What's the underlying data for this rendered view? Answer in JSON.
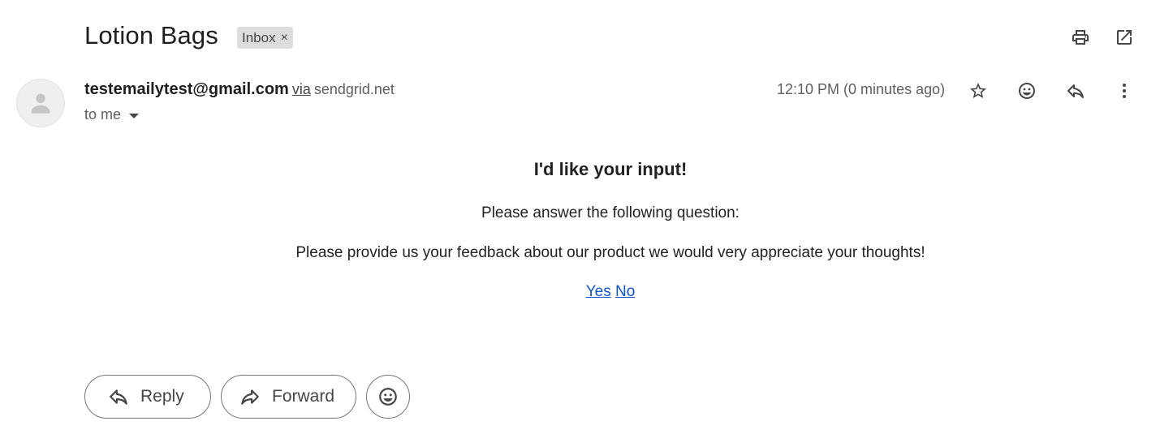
{
  "email": {
    "subject": "Lotion Bags",
    "label": "Inbox",
    "label_remove": "×",
    "sender_email": "testemailytest@gmail.com",
    "via": "via",
    "via_domain": "sendgrid.net",
    "recipients": "to me",
    "timestamp": "12:10 PM (0 minutes ago)"
  },
  "body": {
    "heading": "I'd like your input!",
    "line1": "Please answer the following question:",
    "line2": "Please provide us your feedback about our product we would very appreciate your thoughts!",
    "link_yes": "Yes",
    "link_no": "No"
  },
  "actions": {
    "reply": "Reply",
    "forward": "Forward"
  },
  "icons": {
    "print": "print-icon",
    "open_new_window": "open-in-new-window-icon",
    "star": "star-icon",
    "emoji": "emoji-icon",
    "reply": "reply-icon",
    "more": "more-vert-icon",
    "forward": "forward-icon",
    "avatar": "person-icon"
  },
  "colors": {
    "link": "#1155cc",
    "label_chip_bg": "#dddddd"
  }
}
